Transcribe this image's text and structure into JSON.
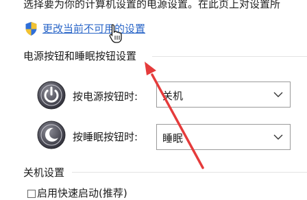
{
  "intro_text": "选择要为你的计算机设置的电源设置。在此页上对设置所",
  "change_link": "更改当前不可用的设置",
  "section_power_buttons": "电源按钮和睡眠按钮设置",
  "power_row": {
    "label": "按电源按钮时:",
    "value": "关机"
  },
  "sleep_row": {
    "label": "按睡眠按钮时:",
    "value": "睡眠"
  },
  "section_shutdown": "关机设置",
  "shutdown_partial_item": "启用快速启动(推荐)",
  "icons": {
    "shield": "shield-icon",
    "power": "power-icon",
    "sleep": "sleep-icon",
    "cursor": "hand-cursor-icon",
    "chevron": "chevron-down-icon"
  },
  "colors": {
    "link": "#2a66c8",
    "annotation_arrow": "#e53b3b"
  }
}
